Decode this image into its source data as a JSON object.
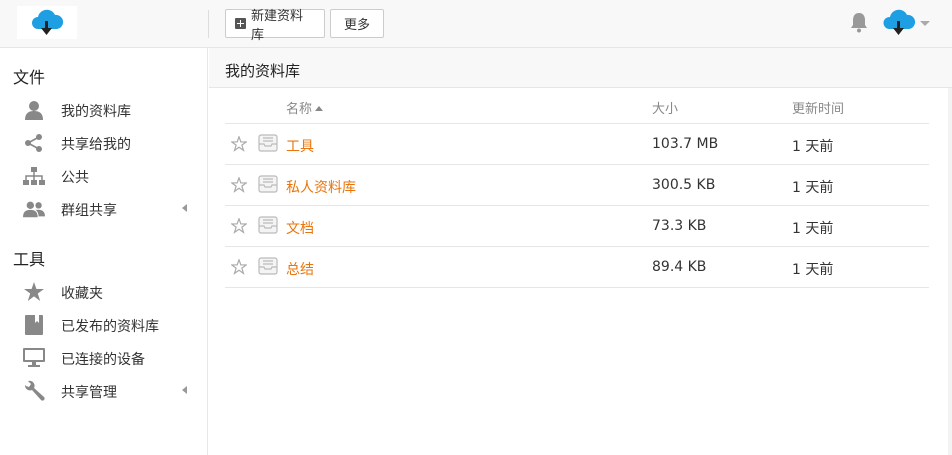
{
  "header": {
    "new_library_label": "新建资料库",
    "more_label": "更多",
    "accent_color": "#1e9ee3"
  },
  "sidebar": {
    "files_heading": "文件",
    "files_items": [
      {
        "label": "我的资料库",
        "icon": "user-icon"
      },
      {
        "label": "共享给我的",
        "icon": "share-icon"
      },
      {
        "label": "公共",
        "icon": "org-chart-icon"
      },
      {
        "label": "群组共享",
        "icon": "group-icon",
        "expandable": true
      }
    ],
    "tools_heading": "工具",
    "tools_items": [
      {
        "label": "收藏夹",
        "icon": "star-icon"
      },
      {
        "label": "已发布的资料库",
        "icon": "book-icon"
      },
      {
        "label": "已连接的设备",
        "icon": "monitor-icon"
      },
      {
        "label": "共享管理",
        "icon": "wrench-icon",
        "expandable": true
      }
    ]
  },
  "main": {
    "title": "我的资料库",
    "columns": {
      "name": "名称",
      "size": "大小",
      "modified": "更新时间"
    },
    "sort": {
      "column": "name",
      "direction": "ascending"
    },
    "rows": [
      {
        "name": "工具",
        "size": "103.7 MB",
        "modified": "1 天前"
      },
      {
        "name": "私人资料库",
        "size": "300.5 KB",
        "modified": "1 天前"
      },
      {
        "name": "文档",
        "size": "73.3 KB",
        "modified": "1 天前"
      },
      {
        "name": "总结",
        "size": "89.4 KB",
        "modified": "1 天前"
      }
    ],
    "link_color": "#e8760c"
  }
}
